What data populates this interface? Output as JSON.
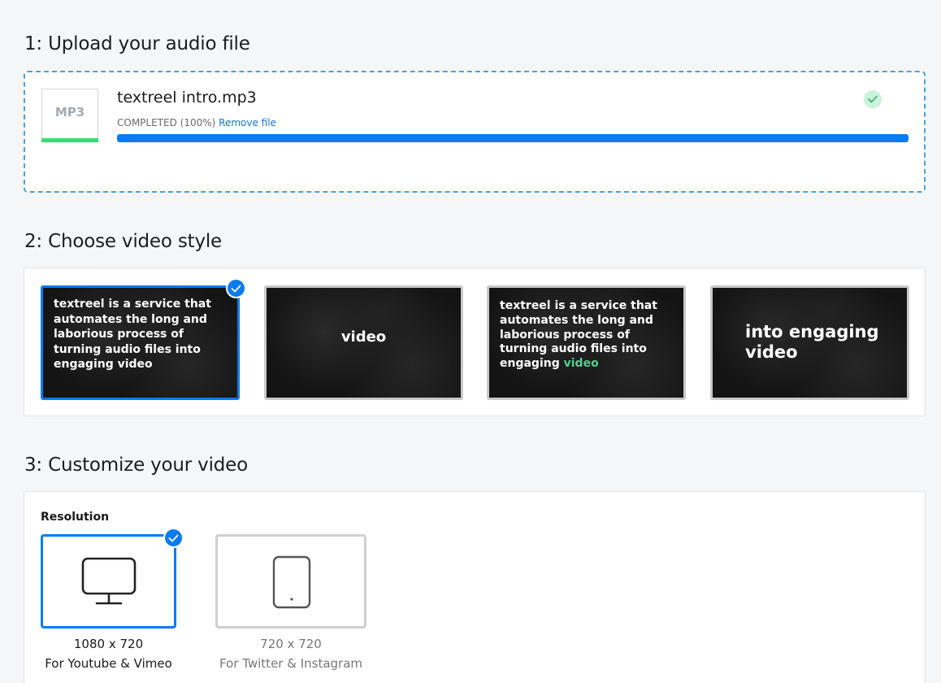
{
  "sections": {
    "upload_title": "1: Upload your audio file",
    "style_title": "2: Choose video style",
    "customize_title": "3: Customize your video"
  },
  "upload": {
    "file_ext": "MP3",
    "file_name": "textreel intro.mp3",
    "status": "COMPLETED (100%)",
    "remove_link": "Remove file",
    "progress": 1.0,
    "status_icon": "check-icon"
  },
  "styles": [
    {
      "text": "textreel is a service that automates the long and laborious process of turning audio files into engaging video",
      "selected": true
    },
    {
      "text": "video",
      "selected": false
    },
    {
      "text_main": "textreel is a service that automates the long and laborious process of turning audio files into engaging",
      "text_highlight": "video",
      "highlight_color": "#4fd08f",
      "selected": false
    },
    {
      "text": "into engaging video",
      "selected": false
    }
  ],
  "customize": {
    "resolution_label": "Resolution",
    "options": [
      {
        "size": "1080 x 720",
        "platform": "For Youtube & Vimeo",
        "icon": "monitor-icon",
        "selected": true
      },
      {
        "size": "720 x 720",
        "platform": "For Twitter & Instagram",
        "icon": "tablet-icon",
        "selected": false
      }
    ]
  },
  "colors": {
    "accent": "#0c7bf0",
    "success": "#37de6e",
    "link": "#1376e0"
  }
}
